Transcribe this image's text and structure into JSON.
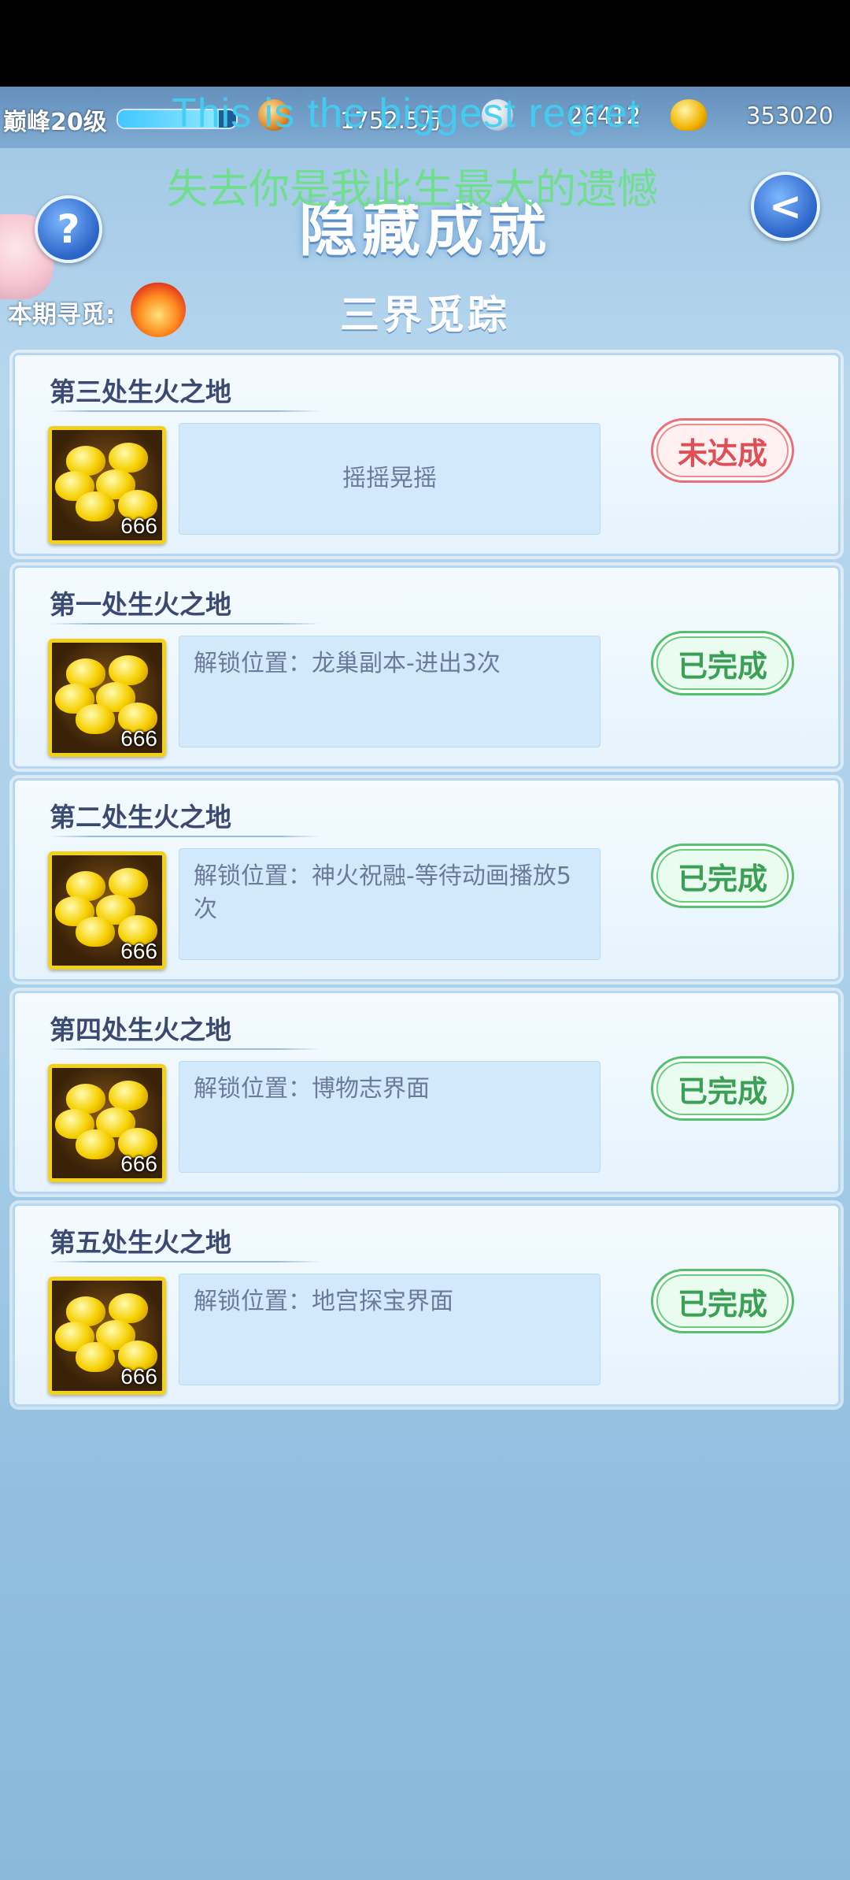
{
  "header": {
    "level": "巅峰20级",
    "level_progress": 0.85,
    "resource1": "1752.5万",
    "resource2": "26412",
    "resource3": "353020"
  },
  "overlay": {
    "english": "This is the biggest regret",
    "chinese": "失去你是我此生最大的遗憾"
  },
  "page": {
    "title": "隐藏成就",
    "period_label": "本期寻觅:",
    "subtitle": "三界觅踪",
    "help_symbol": "?",
    "back_symbol": "<"
  },
  "cards": [
    {
      "title": "第三处生火之地",
      "reward": "666",
      "desc": "摇摇晃摇",
      "status": "未达成"
    },
    {
      "title": "第一处生火之地",
      "reward": "666",
      "desc": "解锁位置：龙巢副本-进出3次",
      "status": "已完成"
    },
    {
      "title": "第二处生火之地",
      "reward": "666",
      "desc": "解锁位置：神火祝融-等待动画播放5次",
      "status": "已完成"
    },
    {
      "title": "第四处生火之地",
      "reward": "666",
      "desc": "解锁位置：博物志界面",
      "status": "已完成"
    },
    {
      "title": "第五处生火之地",
      "reward": "666",
      "desc": "解锁位置：地宫探宝界面",
      "status": "已完成"
    }
  ],
  "colors": {
    "done": "#56c06e",
    "todo": "#ea7078",
    "title": "#3c4a72"
  }
}
